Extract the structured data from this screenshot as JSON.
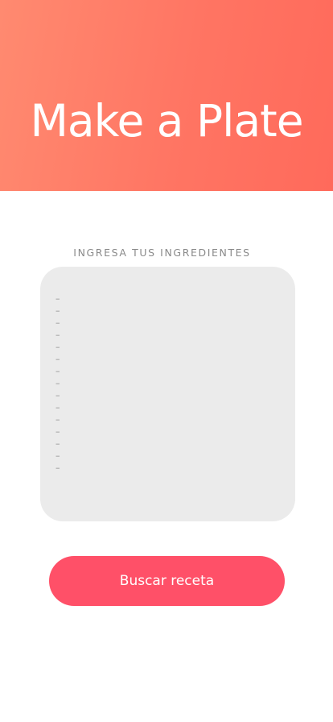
{
  "header": {
    "title": "Make a Plate"
  },
  "ingredients": {
    "label": "INGRESA TUS INGREDIENTES",
    "lines": [
      "–",
      "–",
      "–",
      "–",
      "–",
      "–",
      "–",
      "–",
      "–",
      "–",
      "–",
      "–",
      "–",
      "–",
      "–"
    ]
  },
  "search_button": {
    "label": "Buscar receta"
  },
  "colors": {
    "header_gradient_start": "#ff8a70",
    "header_gradient_end": "#ff6a5b",
    "button": "#ff5068",
    "input_background": "#ebebeb"
  }
}
